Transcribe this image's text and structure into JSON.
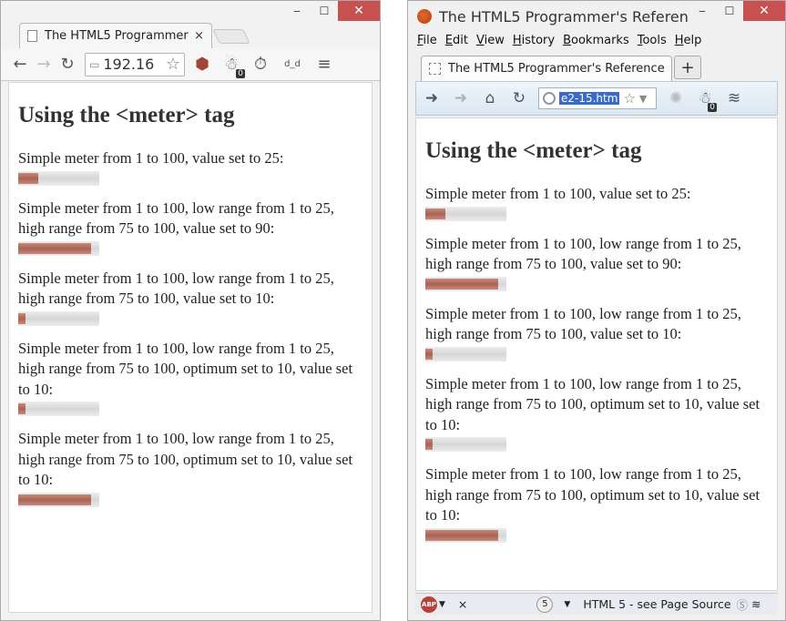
{
  "chrome": {
    "tab_title": "The HTML5 Programmer's",
    "tab_close": "×",
    "omnibox_text": "192.16",
    "badge": "0",
    "ext_label": "d_d",
    "controls": {
      "minimize": "‒",
      "maximize": "☐",
      "close": "✕"
    }
  },
  "firefox": {
    "window_title": "The HTML5 Programmer's Referen",
    "menu": [
      "File",
      "Edit",
      "View",
      "History",
      "Bookmarks",
      "Tools",
      "Help"
    ],
    "menu_underlines": [
      "F",
      "E",
      "V",
      "H",
      "B",
      "T",
      "H"
    ],
    "tab_title": "The HTML5 Programmer's Reference",
    "new_tab": "+",
    "url_text": "e2-15.htm",
    "badge": "0",
    "status": {
      "abp": "ABP",
      "close": "×",
      "counter": "5",
      "text": "HTML 5 - see Page Source"
    },
    "controls": {
      "minimize": "‒",
      "maximize": "☐",
      "close": "✕"
    }
  },
  "page": {
    "heading": "Using the <meter> tag",
    "meters": [
      {
        "text": "Simple meter from 1 to 100, value set to 25:",
        "value": 25,
        "min": 1,
        "max": 100
      },
      {
        "text": "Simple meter from 1 to 100, low range from 1 to 25, high range from 75 to 100, value set to 90:",
        "value": 90,
        "min": 1,
        "max": 100
      },
      {
        "text": "Simple meter from 1 to 100, low range from 1 to 25, high range from 75 to 100, value set to 10:",
        "value": 10,
        "min": 1,
        "max": 100
      },
      {
        "text": "Simple meter from 1 to 100, low range from 1 to 25, high range from 75 to 100, optimum set to 10, value set to 10:",
        "value": 10,
        "min": 1,
        "max": 100
      },
      {
        "text": "Simple meter from 1 to 100, low range from 1 to 25, high range from 75 to 100, optimum set to 10, value set to 10:",
        "value": 90,
        "min": 1,
        "max": 100
      }
    ]
  },
  "colors": {
    "meter_fill": "#a86253",
    "meter_track": "#dcdcdc",
    "close_button": "#c75050"
  }
}
